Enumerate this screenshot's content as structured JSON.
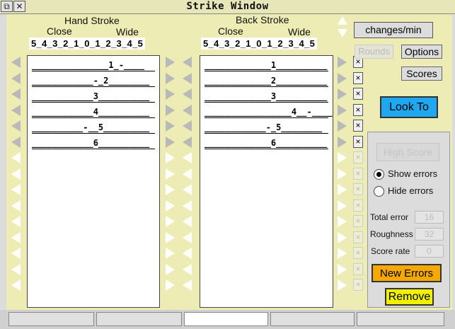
{
  "window": {
    "title": "Strike Window"
  },
  "hand": {
    "title": "Hand Stroke",
    "close": "Close",
    "wide": "Wide",
    "scale": "5_4_3_2_1_0_1_2_3_4_5",
    "rows": [
      "_______________1_-____",
      "____________-_2________",
      "____________3__________",
      "____________4__________",
      "__________-__5_________",
      "____________6__________"
    ]
  },
  "back": {
    "title": "Back Stroke",
    "close": "Close",
    "wide": "Wide",
    "scale": "5_4_3_2_1_0_1_2_3_4_5",
    "rows": [
      "_____________1__________",
      "_____________2__________",
      "_____________3__________",
      "_________________4__-____",
      "____________-_5________",
      "_____________6__________"
    ]
  },
  "controls": {
    "rate_label": "changes/min",
    "rounds": "Rounds",
    "options": "Options",
    "scores": "Scores",
    "look_to": "Look To",
    "high_score": "High Score",
    "show_errors": "Show errors",
    "hide_errors": "Hide errors",
    "total_error_label": "Total error",
    "total_error_value": "16",
    "roughness_label": "Roughness",
    "roughness_value": "32",
    "score_rate_label": "Score rate",
    "score_rate_value": "0",
    "new_errors": "New Errors",
    "remove": "Remove"
  },
  "colors": {
    "panel": "#ececb4",
    "look_to": "#1fa7ef",
    "new_errors": "#f5a800",
    "remove": "#f0f000"
  },
  "icons": {
    "row_left": "left-arrow-icon",
    "row_right": "right-arrow-icon",
    "row_delete": "x-icon",
    "scroll": "up-down-arrow-icon"
  }
}
